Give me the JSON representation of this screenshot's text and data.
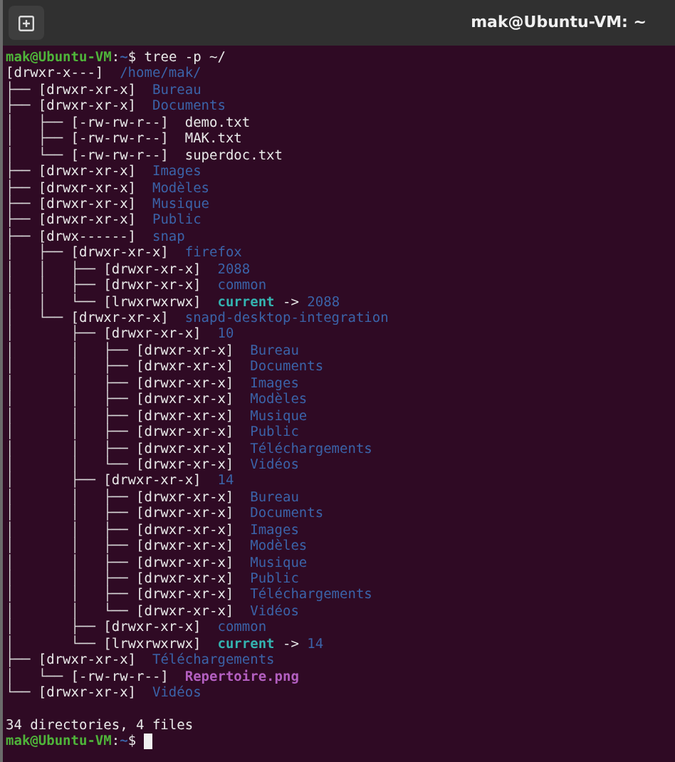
{
  "window": {
    "title": "mak@Ubuntu-VM: ~"
  },
  "command_line": {
    "user_host": "mak@Ubuntu-VM",
    "separator": ":",
    "path": "~",
    "symbol": "$",
    "command": "tree -p ~/"
  },
  "tree": {
    "perms": "[drwxr-x---]",
    "name": "/home/mak/",
    "kind": "dir",
    "children": [
      {
        "prefix": "├── ",
        "perms": "[drwxr-xr-x]",
        "name": "Bureau",
        "kind": "dir"
      },
      {
        "prefix": "├── ",
        "perms": "[drwxr-xr-x]",
        "name": "Documents",
        "kind": "dir",
        "children": [
          {
            "prefix": "│   ├── ",
            "perms": "[-rw-rw-r--]",
            "name": "demo.txt",
            "kind": "file"
          },
          {
            "prefix": "│   ├── ",
            "perms": "[-rw-rw-r--]",
            "name": "MAK.txt",
            "kind": "file"
          },
          {
            "prefix": "│   └── ",
            "perms": "[-rw-rw-r--]",
            "name": "superdoc.txt",
            "kind": "file"
          }
        ]
      },
      {
        "prefix": "├── ",
        "perms": "[drwxr-xr-x]",
        "name": "Images",
        "kind": "dir"
      },
      {
        "prefix": "├── ",
        "perms": "[drwxr-xr-x]",
        "name": "Modèles",
        "kind": "dir"
      },
      {
        "prefix": "├── ",
        "perms": "[drwxr-xr-x]",
        "name": "Musique",
        "kind": "dir"
      },
      {
        "prefix": "├── ",
        "perms": "[drwxr-xr-x]",
        "name": "Public",
        "kind": "dir"
      },
      {
        "prefix": "├── ",
        "perms": "[drwx------]",
        "name": "snap",
        "kind": "dir",
        "children": [
          {
            "prefix": "│   ├── ",
            "perms": "[drwxr-xr-x]",
            "name": "firefox",
            "kind": "dir",
            "children": [
              {
                "prefix": "│   │   ├── ",
                "perms": "[drwxr-xr-x]",
                "name": "2088",
                "kind": "dir"
              },
              {
                "prefix": "│   │   ├── ",
                "perms": "[drwxr-xr-x]",
                "name": "common",
                "kind": "dir"
              },
              {
                "prefix": "│   │   └── ",
                "perms": "[lrwxrwxrwx]",
                "name": "current",
                "kind": "link",
                "arrow": "->",
                "target": "2088"
              }
            ]
          },
          {
            "prefix": "│   └── ",
            "perms": "[drwxr-xr-x]",
            "name": "snapd-desktop-integration",
            "kind": "dir",
            "children": [
              {
                "prefix": "│       ├── ",
                "perms": "[drwxr-xr-x]",
                "name": "10",
                "kind": "dir",
                "children": [
                  {
                    "prefix": "│       │   ├── ",
                    "perms": "[drwxr-xr-x]",
                    "name": "Bureau",
                    "kind": "dir"
                  },
                  {
                    "prefix": "│       │   ├── ",
                    "perms": "[drwxr-xr-x]",
                    "name": "Documents",
                    "kind": "dir"
                  },
                  {
                    "prefix": "│       │   ├── ",
                    "perms": "[drwxr-xr-x]",
                    "name": "Images",
                    "kind": "dir"
                  },
                  {
                    "prefix": "│       │   ├── ",
                    "perms": "[drwxr-xr-x]",
                    "name": "Modèles",
                    "kind": "dir"
                  },
                  {
                    "prefix": "│       │   ├── ",
                    "perms": "[drwxr-xr-x]",
                    "name": "Musique",
                    "kind": "dir"
                  },
                  {
                    "prefix": "│       │   ├── ",
                    "perms": "[drwxr-xr-x]",
                    "name": "Public",
                    "kind": "dir"
                  },
                  {
                    "prefix": "│       │   ├── ",
                    "perms": "[drwxr-xr-x]",
                    "name": "Téléchargements",
                    "kind": "dir"
                  },
                  {
                    "prefix": "│       │   └── ",
                    "perms": "[drwxr-xr-x]",
                    "name": "Vidéos",
                    "kind": "dir"
                  }
                ]
              },
              {
                "prefix": "│       ├── ",
                "perms": "[drwxr-xr-x]",
                "name": "14",
                "kind": "dir",
                "children": [
                  {
                    "prefix": "│       │   ├── ",
                    "perms": "[drwxr-xr-x]",
                    "name": "Bureau",
                    "kind": "dir"
                  },
                  {
                    "prefix": "│       │   ├── ",
                    "perms": "[drwxr-xr-x]",
                    "name": "Documents",
                    "kind": "dir"
                  },
                  {
                    "prefix": "│       │   ├── ",
                    "perms": "[drwxr-xr-x]",
                    "name": "Images",
                    "kind": "dir"
                  },
                  {
                    "prefix": "│       │   ├── ",
                    "perms": "[drwxr-xr-x]",
                    "name": "Modèles",
                    "kind": "dir"
                  },
                  {
                    "prefix": "│       │   ├── ",
                    "perms": "[drwxr-xr-x]",
                    "name": "Musique",
                    "kind": "dir"
                  },
                  {
                    "prefix": "│       │   ├── ",
                    "perms": "[drwxr-xr-x]",
                    "name": "Public",
                    "kind": "dir"
                  },
                  {
                    "prefix": "│       │   ├── ",
                    "perms": "[drwxr-xr-x]",
                    "name": "Téléchargements",
                    "kind": "dir"
                  },
                  {
                    "prefix": "│       │   └── ",
                    "perms": "[drwxr-xr-x]",
                    "name": "Vidéos",
                    "kind": "dir"
                  }
                ]
              },
              {
                "prefix": "│       ├── ",
                "perms": "[drwxr-xr-x]",
                "name": "common",
                "kind": "dir"
              },
              {
                "prefix": "│       └── ",
                "perms": "[lrwxrwxrwx]",
                "name": "current",
                "kind": "link",
                "arrow": "->",
                "target": "14"
              }
            ]
          }
        ]
      },
      {
        "prefix": "├── ",
        "perms": "[drwxr-xr-x]",
        "name": "Téléchargements",
        "kind": "dir",
        "children": [
          {
            "prefix": "│   └── ",
            "perms": "[-rw-rw-r--]",
            "name": "Repertoire.png",
            "kind": "image"
          }
        ]
      },
      {
        "prefix": "└── ",
        "perms": "[drwxr-xr-x]",
        "name": "Vidéos",
        "kind": "dir"
      }
    ]
  },
  "summary": "34 directories, 4 files",
  "prompt": {
    "user_host": "mak@Ubuntu-VM",
    "separator": ":",
    "path": "~",
    "symbol": "$"
  }
}
